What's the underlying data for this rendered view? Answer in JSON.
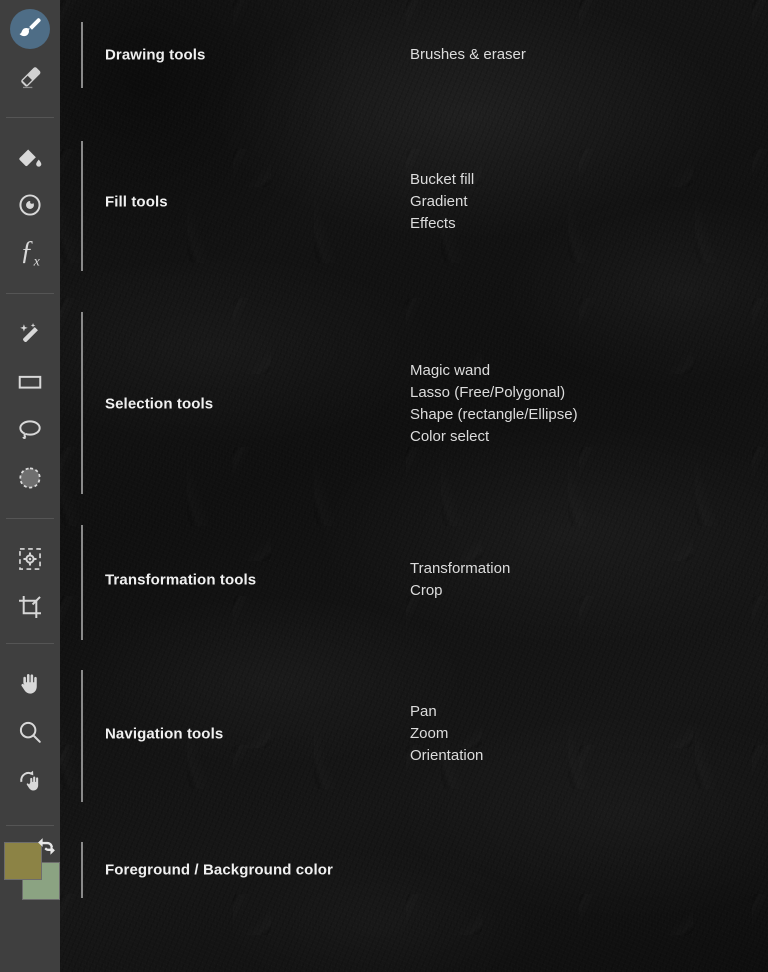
{
  "toolbar": {
    "name": "tool-rail",
    "active_tool": "brush",
    "tools": [
      {
        "id": "brush",
        "icon": "brush-icon",
        "label": "Brush",
        "active": true
      },
      {
        "id": "eraser",
        "icon": "eraser-icon",
        "label": "Eraser",
        "active": false
      },
      {
        "id": "bucket-fill",
        "icon": "paint-bucket-icon",
        "label": "Bucket fill",
        "active": false
      },
      {
        "id": "gradient",
        "icon": "gradient-icon",
        "label": "Gradient",
        "active": false
      },
      {
        "id": "effects",
        "icon": "effects-fx-icon",
        "label": "Effects",
        "active": false
      },
      {
        "id": "magic-wand",
        "icon": "magic-wand-icon",
        "label": "Magic wand",
        "active": false
      },
      {
        "id": "shape-select",
        "icon": "rectangle-select-icon",
        "label": "Shape select",
        "active": false
      },
      {
        "id": "lasso",
        "icon": "lasso-icon",
        "label": "Lasso",
        "active": false
      },
      {
        "id": "color-select",
        "icon": "color-select-icon",
        "label": "Color select",
        "active": false
      },
      {
        "id": "transformation",
        "icon": "transform-icon",
        "label": "Transformation",
        "active": false
      },
      {
        "id": "crop",
        "icon": "crop-icon",
        "label": "Crop",
        "active": false
      },
      {
        "id": "pan",
        "icon": "hand-pan-icon",
        "label": "Pan",
        "active": false
      },
      {
        "id": "zoom",
        "icon": "magnifier-zoom-icon",
        "label": "Zoom",
        "active": false
      },
      {
        "id": "orientation",
        "icon": "rotate-hand-icon",
        "label": "Orientation",
        "active": false
      }
    ],
    "color_swatches": {
      "name": "foreground-background-swatches",
      "foreground_color": "#8c8345",
      "background_color": "#8ba382",
      "swap_icon": "swap-arrows-icon"
    }
  },
  "sections": [
    {
      "label": "Drawing tools",
      "items": [
        "Brushes & eraser"
      ]
    },
    {
      "label": "Fill tools",
      "items": [
        "Bucket fill",
        "Gradient",
        "Effects"
      ]
    },
    {
      "label": "Selection tools",
      "items": [
        "Magic wand",
        "Lasso (Free/Polygonal)",
        "Shape (rectangle/Ellipse)",
        "Color select"
      ]
    },
    {
      "label": "Transformation tools",
      "items": [
        "Transformation",
        "Crop"
      ]
    },
    {
      "label": "Navigation tools",
      "items": [
        "Pan",
        "Zoom",
        "Orientation"
      ]
    },
    {
      "label": "Foreground / Background color",
      "items": []
    }
  ]
}
